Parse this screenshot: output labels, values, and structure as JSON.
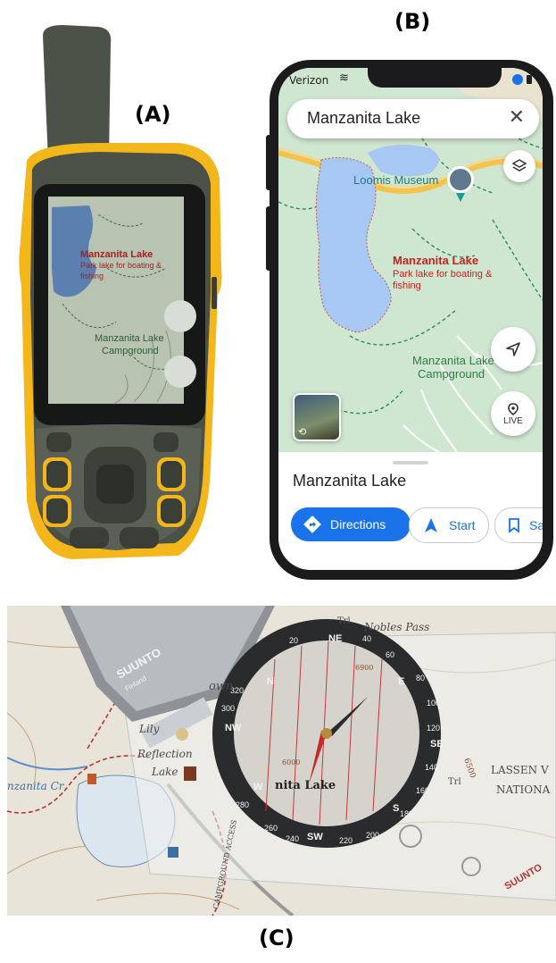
{
  "labels": {
    "a": "(A)",
    "b": "(B)",
    "c": "(C)"
  },
  "gps_screen": {
    "lake_name": "Manzanita Lake",
    "lake_desc_1": "Park lake for boating &",
    "lake_desc_2": "fishing",
    "campground_1": "Manzanita Lake",
    "campground_2": "Campground"
  },
  "phone": {
    "carrier": "Verizon",
    "search_value": "Manzanita Lake",
    "museum_label": "Loomis Museum",
    "lake_name": "Manzanita Lake",
    "lake_desc_1": "Park lake for boating &",
    "lake_desc_2": "fishing",
    "campground_1": "Manzanita Lake",
    "campground_2": "Campground",
    "live_label": "LIVE",
    "sheet_title": "Manzanita Lake",
    "directions_label": "Directions",
    "start_label": "Start",
    "save_label": "Sav"
  },
  "compass_photo": {
    "brand_top": "SUUNTO",
    "brand_top_sub": "Finland",
    "brand_bottom": "SUUNTO",
    "map_trail": "Trl",
    "map_pass": "Nobles Pass",
    "map_lake1": "Lily",
    "map_lake2": "Reflection",
    "map_lake3": "Lake",
    "map_creek": "nzanita Cr",
    "map_manz": "nita Lake",
    "map_lassen1": "LASSEN V",
    "map_lassen2": "NATIONA",
    "map_road": "CAMPGROUND ACCESS",
    "map_town": "own",
    "dial_n": "N",
    "dial_ne": "NE",
    "dial_e": "E",
    "dial_se": "SE",
    "dial_s": "S",
    "dial_sw": "SW",
    "dial_w": "W",
    "dial_nw": "NW",
    "deg_40": "40",
    "deg_60": "60",
    "deg_80": "80",
    "deg_100": "100",
    "deg_120": "120",
    "deg_140": "140",
    "deg_160": "160",
    "deg_200": "200",
    "deg_220": "220",
    "deg_240": "240",
    "deg_260": "260",
    "deg_280": "280",
    "deg_300": "300",
    "deg_320": "320",
    "deg_20": "20",
    "deg_180": "180",
    "elev_6000": "6000",
    "elev_6500": "6500",
    "elev_6900": "6900"
  },
  "colors": {
    "map_water": "#a7c8f2",
    "map_land": "#cfe6d1",
    "map_red_label": "#c5221f",
    "gps_yellow": "#f3b61b",
    "gps_body": "#4c5148",
    "maps_blue": "#1a73e8"
  },
  "icons": [
    "close-icon",
    "layers-icon",
    "navigate-icon",
    "live-view-icon",
    "directions-icon",
    "start-arrow-icon",
    "bookmark-icon",
    "wifi-icon",
    "location-arrow-icon"
  ]
}
